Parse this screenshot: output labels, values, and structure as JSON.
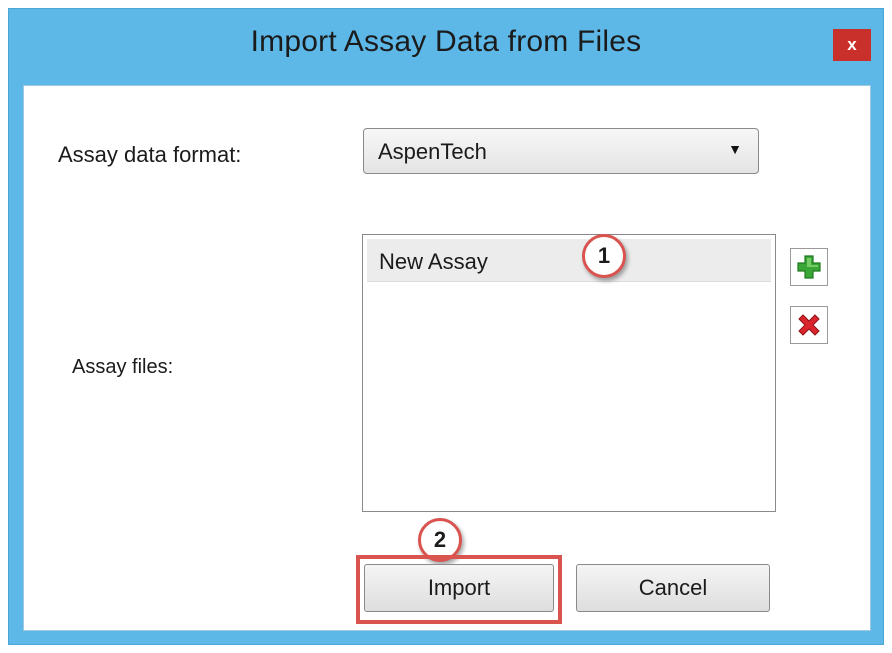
{
  "window": {
    "title": "Import Assay Data from Files",
    "close_label": "x"
  },
  "form": {
    "format_label": "Assay data format:",
    "format_value": "AspenTech",
    "files_label": "Assay files:",
    "files": [
      {
        "label": "New Assay"
      }
    ]
  },
  "buttons": {
    "import_label": "Import",
    "cancel_label": "Cancel"
  },
  "icons": {
    "add": "plus-icon",
    "remove": "x-icon",
    "dropdown": "chevron-down-icon"
  },
  "annotations": {
    "callout_1": "1",
    "callout_2": "2"
  },
  "colors": {
    "title_bar": "#5db8e8",
    "close_button": "#c9302c",
    "add_icon": "#3aa635",
    "remove_icon": "#d9252b",
    "highlight": "#d9534f"
  }
}
